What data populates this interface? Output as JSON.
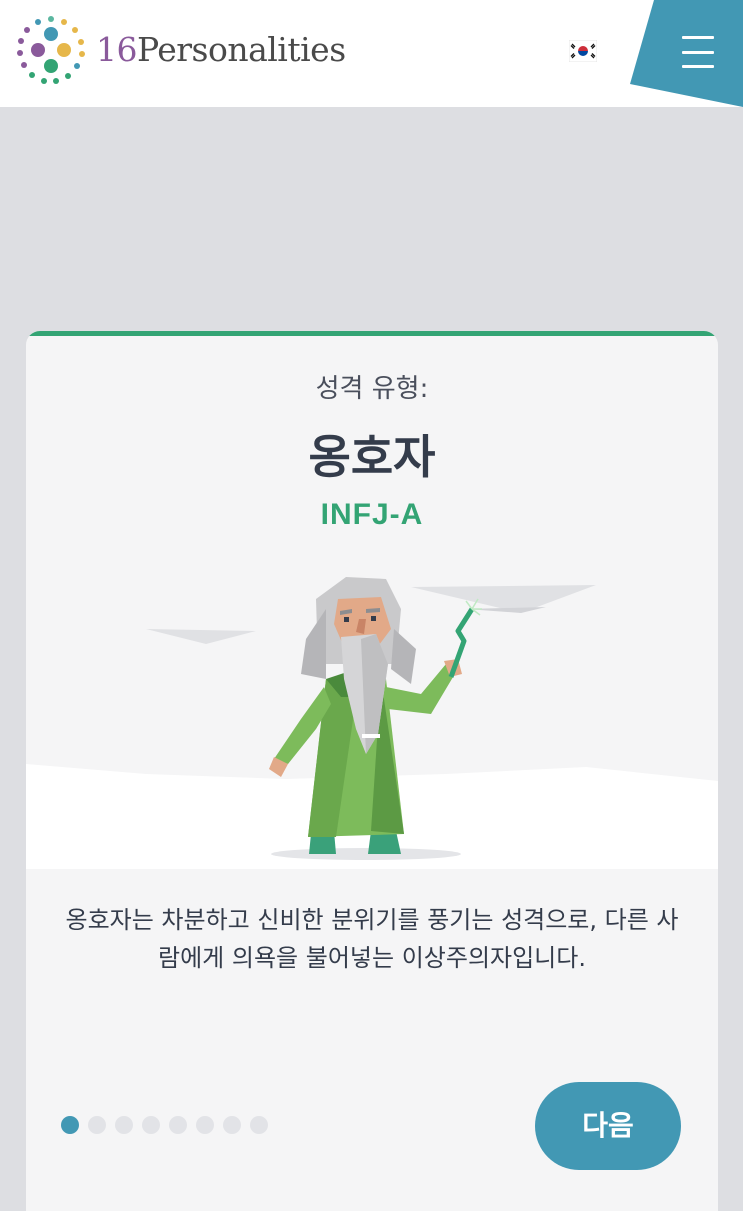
{
  "header": {
    "logo_number": "16",
    "logo_word": "Personalities",
    "language_flag": "south-korea-flag-icon",
    "menu_icon": "hamburger-menu-icon",
    "colors": {
      "menu_bg": "#4298b4",
      "header_bg": "#ffffff"
    }
  },
  "card": {
    "label": "성격 유형:",
    "type_name": "옹호자",
    "type_code": "INFJ-A",
    "illustration": "advocate-sage-character",
    "description": "옹호자는 차분하고 신비한 분위기를 풍기는 성격으로, 다른 사람에게 의욕을 불어넣는 이상주의자입니다.",
    "pagination": {
      "total": 8,
      "current": 1
    },
    "next_label": "다음",
    "colors": {
      "accent": "#33a474",
      "button": "#4298b4",
      "text": "#343c4b"
    }
  }
}
